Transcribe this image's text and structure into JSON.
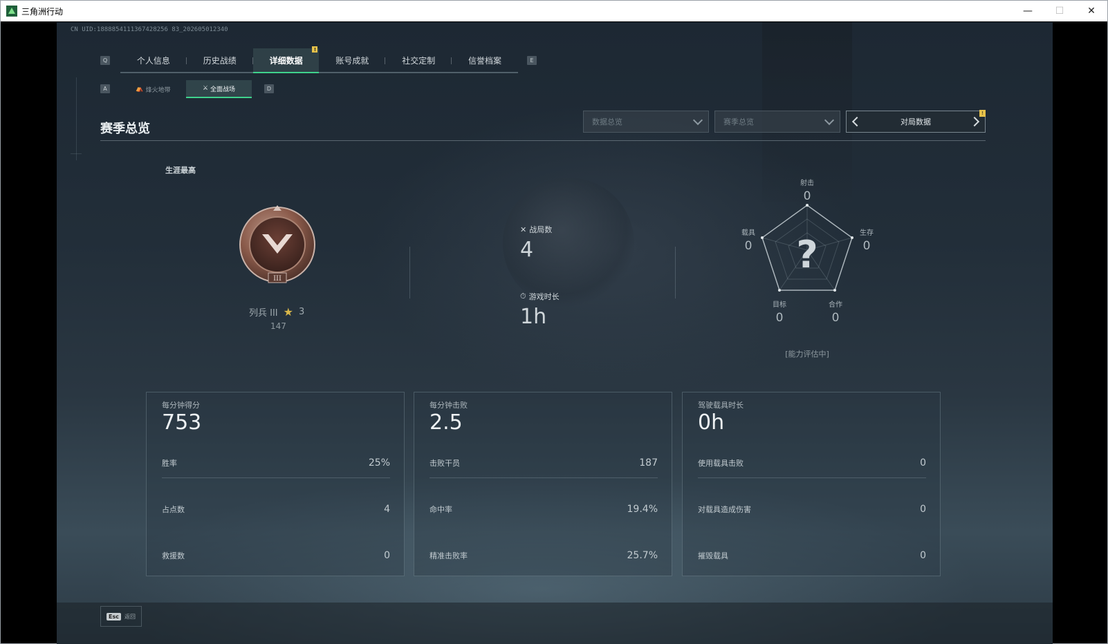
{
  "window": {
    "title": "三角洲行动",
    "minimize": "—",
    "maximize": "☐",
    "close": "✕"
  },
  "uid": "CN UID:1888854111367428256 83_202605012340",
  "nav": {
    "prev_key": "Q",
    "next_key": "E",
    "tabs": [
      {
        "label": "个人信息"
      },
      {
        "label": "历史战绩"
      },
      {
        "label": "详细数据",
        "active": true,
        "alert": "!"
      },
      {
        "label": "账号成就"
      },
      {
        "label": "社交定制"
      },
      {
        "label": "信誉档案"
      }
    ]
  },
  "subnav": {
    "prev_key": "A",
    "next_key": "D",
    "tabs": [
      {
        "label": "烽火地带"
      },
      {
        "label": "全面战场",
        "active": true
      }
    ]
  },
  "section": {
    "title": "赛季总览"
  },
  "filters": {
    "data_overview": "数据总览",
    "season_overview": "赛季总览",
    "match_data": "对局数据",
    "alert": "!"
  },
  "career": {
    "label": "生涯最高",
    "rank_name": "列兵 III",
    "stars": "3",
    "points": "147",
    "badge_numeral": "III"
  },
  "stats": {
    "matches_label": "战局数",
    "matches_value": "4",
    "playtime_label": "游戏时长",
    "playtime_value": "1h"
  },
  "radar": {
    "shooting_label": "射击",
    "shooting_value": "0",
    "survival_label": "生存",
    "survival_value": "0",
    "cooperation_label": "合作",
    "cooperation_value": "0",
    "objective_label": "目标",
    "objective_value": "0",
    "vehicle_label": "载具",
    "vehicle_value": "0",
    "status": "[能力评估中]",
    "center_mark": "?"
  },
  "cards": [
    {
      "title": "每分钟得分",
      "big": "753",
      "rows": [
        {
          "label": "胜率",
          "value": "25%"
        },
        {
          "label": "占点数",
          "value": "4"
        },
        {
          "label": "救援数",
          "value": "0"
        }
      ]
    },
    {
      "title": "每分钟击败",
      "big": "2.5",
      "rows": [
        {
          "label": "击败干员",
          "value": "187"
        },
        {
          "label": "命中率",
          "value": "19.4%"
        },
        {
          "label": "精准击败率",
          "value": "25.7%"
        }
      ]
    },
    {
      "title": "驾驶载具时长",
      "big": "0h",
      "rows": [
        {
          "label": "使用载具击败",
          "value": "0"
        },
        {
          "label": "对载具造成伤害",
          "value": "0"
        },
        {
          "label": "摧毁载具",
          "value": "0"
        }
      ]
    }
  ],
  "footer": {
    "esc_key": "Esc",
    "back_label": "返回"
  },
  "colors": {
    "accent": "#3fd38d",
    "alert": "#e6c14a",
    "rank_bronze": "#8a5a4a"
  }
}
